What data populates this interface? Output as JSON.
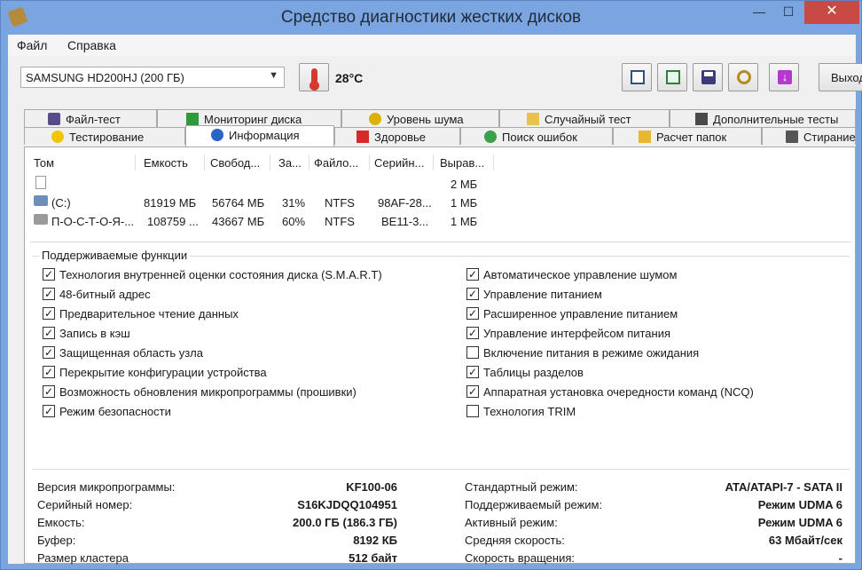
{
  "window": {
    "title": "Средство диагностики жестких дисков",
    "min_glyph": "—",
    "max_glyph": "☐",
    "close_glyph": "✕"
  },
  "menu": {
    "file": "Файл",
    "help": "Справка"
  },
  "toolbar": {
    "drive": "SAMSUNG HD200HJ (200 ГБ)",
    "temperature": "28°C",
    "exit_label": "Выход",
    "icons": [
      "copy-info-icon",
      "copy-report-icon",
      "save-icon",
      "link-icon",
      "download-icon"
    ]
  },
  "tabs": {
    "row1": [
      "Файл-тест",
      "Мониторинг диска",
      "Уровень шума",
      "Случайный тест",
      "Дополнительные тесты"
    ],
    "row2": [
      "Тестирование",
      "Информация",
      "Здоровье",
      "Поиск ошибок",
      "Расчет папок",
      "Стирание"
    ],
    "active": "Информация"
  },
  "volumes": {
    "headers": [
      "Том",
      "Емкость",
      "Свобод...",
      "За...",
      "Файло...",
      "Серийн...",
      "Вырав..."
    ],
    "rows": [
      {
        "name": "",
        "capacity": "",
        "free": "",
        "pct": "",
        "fs": "",
        "serial": "",
        "align": "2 МБ"
      },
      {
        "name": "(C:)",
        "capacity": "81919 МБ",
        "free": "56764 МБ",
        "pct": "31%",
        "fs": "NTFS",
        "serial": "98AF-28...",
        "align": "1 МБ"
      },
      {
        "name": "П-О-С-Т-О-Я-...",
        "capacity": "108759 ...",
        "free": "43667 МБ",
        "pct": "60%",
        "fs": "NTFS",
        "serial": "BE11-3...",
        "align": "1 МБ"
      }
    ]
  },
  "features": {
    "title": "Поддерживаемые функции",
    "left": [
      {
        "label": "Технология внутренней оценки состояния диска (S.M.A.R.T)",
        "checked": true
      },
      {
        "label": "48-битный адрес",
        "checked": true
      },
      {
        "label": "Предварительное чтение данных",
        "checked": true
      },
      {
        "label": "Запись в кэш",
        "checked": true
      },
      {
        "label": "Защищенная область узла",
        "checked": true
      },
      {
        "label": "Перекрытие конфигурации устройства",
        "checked": true
      },
      {
        "label": "Возможность обновления микропрограммы (прошивки)",
        "checked": true
      },
      {
        "label": "Режим безопасности",
        "checked": true
      }
    ],
    "right": [
      {
        "label": "Автоматическое управление шумом",
        "checked": true
      },
      {
        "label": "Управление питанием",
        "checked": true
      },
      {
        "label": "Расширенное управление питанием",
        "checked": true
      },
      {
        "label": "Управление интерфейсом питания",
        "checked": true
      },
      {
        "label": "Включение питания в режиме ожидания",
        "checked": false
      },
      {
        "label": "Таблицы разделов",
        "checked": true
      },
      {
        "label": "Аппаратная установка очередности команд (NCQ)",
        "checked": true
      },
      {
        "label": "Технология TRIM",
        "checked": false
      }
    ]
  },
  "details": {
    "left": [
      {
        "label": "Версия микропрограммы:",
        "value": "KF100-06"
      },
      {
        "label": "Серийный номер:",
        "value": "S16KJDQQ104951"
      },
      {
        "label": "Емкость:",
        "value": "200.0 ГБ (186.3 ГБ)"
      },
      {
        "label": "Буфер:",
        "value": "8192 КБ"
      },
      {
        "label": "Размер кластера",
        "value": "512 байт"
      }
    ],
    "right": [
      {
        "label": "Стандартный режим:",
        "value": "ATA/ATAPI-7 - SATA II"
      },
      {
        "label": "Поддерживаемый режим:",
        "value": "Режим UDMA 6"
      },
      {
        "label": "Активный режим:",
        "value": "Режим UDMA 6"
      },
      {
        "label": "Средняя скорость:",
        "value": "63 Мбайт/сек"
      },
      {
        "label": "Скорость вращения:",
        "value": "-"
      }
    ]
  }
}
